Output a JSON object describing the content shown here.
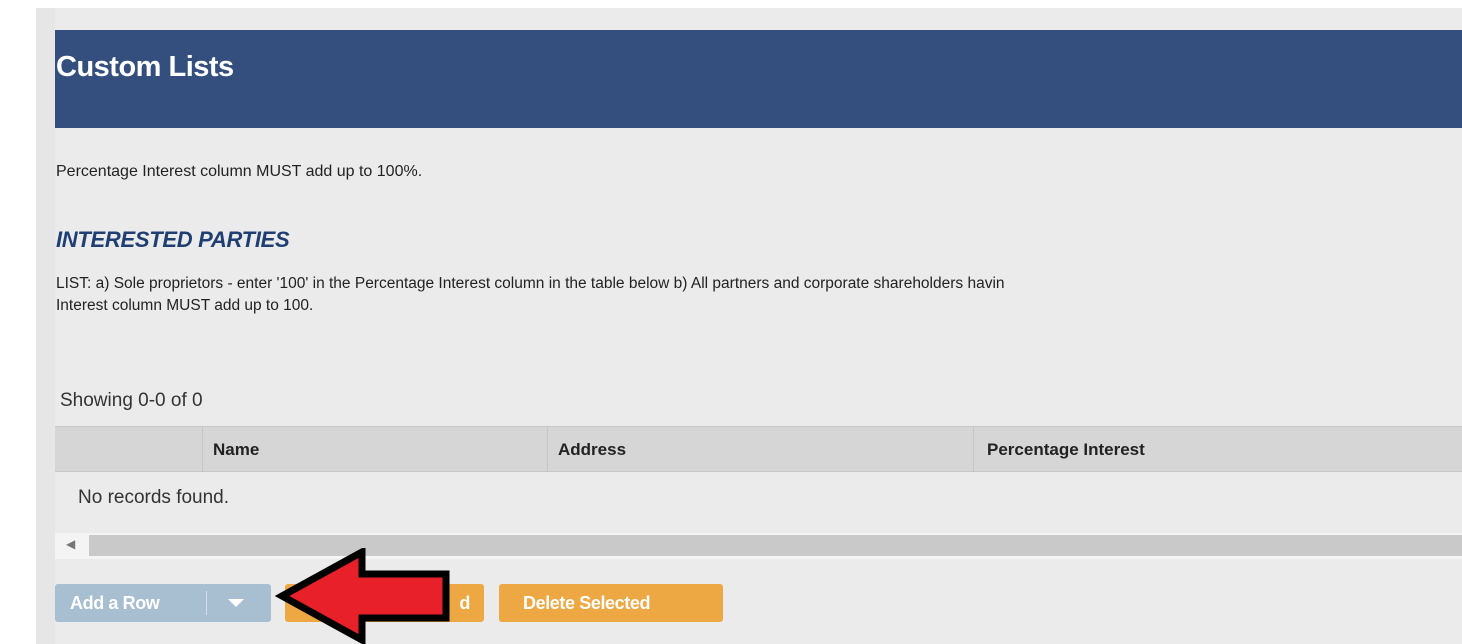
{
  "header": {
    "title": "Custom Lists"
  },
  "note": "Percentage Interest column MUST add up to 100%.",
  "section": {
    "title": "INTERESTED PARTIES",
    "description_line1": "LIST: a) Sole proprietors - enter '100' in the Percentage Interest column in the table below b) All partners and corporate shareholders havin",
    "description_line2": "Interest column MUST add up to 100."
  },
  "table": {
    "showing": "Showing 0-0 of 0",
    "columns": [
      "",
      "Name",
      "Address",
      "Percentage Interest"
    ],
    "rows": [],
    "empty_message": "No records found."
  },
  "actions": {
    "add_row_label": "Add a Row",
    "obscured_button_visible_text": "d",
    "delete_selected_label": "Delete Selected"
  },
  "colors": {
    "header_bg": "#344f7d",
    "section_title": "#1f3f72",
    "add_button_bg": "#a7bfd0",
    "orange_button_bg": "#eda843",
    "annotation_arrow": "#e8202a"
  },
  "annotation": {
    "icon": "red-arrow-icon",
    "points_to": "add-row-dropdown-button"
  }
}
